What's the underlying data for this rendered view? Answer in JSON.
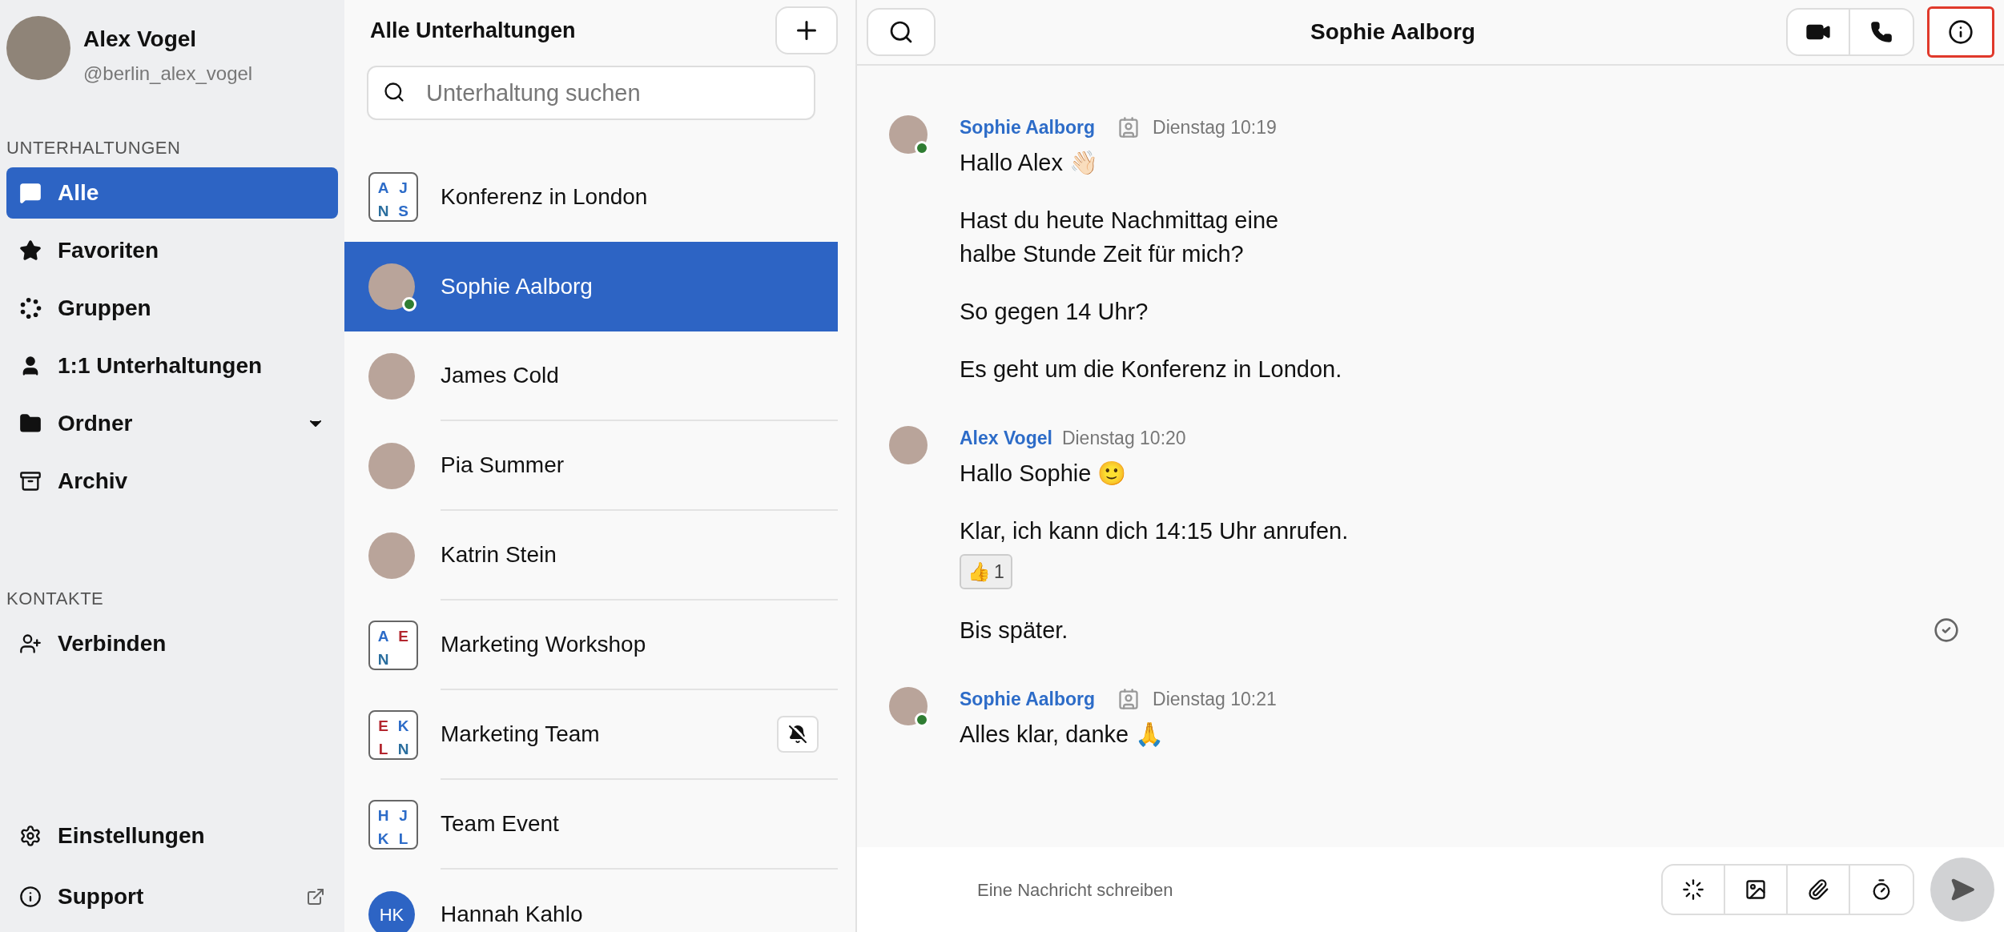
{
  "profile": {
    "name": "Alex Vogel",
    "handle": "@berlin_alex_vogel"
  },
  "sections": [
    {
      "title": "UNTERHALTUNGEN",
      "items": [
        {
          "label": "Alle",
          "selected": true
        },
        {
          "label": "Favoriten",
          "selected": false
        },
        {
          "label": "Gruppen",
          "selected": false
        },
        {
          "label": "1:1 Unterhaltungen",
          "selected": false
        },
        {
          "label": "Ordner",
          "selected": false,
          "dropdown": true
        },
        {
          "label": "Archiv",
          "selected": false
        }
      ]
    },
    {
      "title": "KONTAKTE",
      "items": [
        {
          "label": "Verbinden",
          "selected": false
        }
      ]
    }
  ],
  "bottom_items": [
    {
      "label": "Einstellungen",
      "external": false
    },
    {
      "label": "Support",
      "external": true
    }
  ],
  "conversation_list": {
    "title": "Alle Unterhaltungen",
    "search": {
      "placeholder": "Unterhaltung suchen"
    },
    "items": [
      {
        "name": "Konferenz in London",
        "kind": "group",
        "selected": false,
        "initials": [
          {
            "letter": "A",
            "color": "#2d6cc8"
          },
          {
            "letter": "J",
            "color": "#2d6cc8"
          },
          {
            "letter": "N",
            "color": "#2a6e9e"
          },
          {
            "letter": "S",
            "color": "#2d6cc8"
          }
        ]
      },
      {
        "name": "Sophie Aalborg",
        "kind": "photo",
        "selected": true,
        "online": true
      },
      {
        "name": "James Cold",
        "kind": "photo",
        "selected": false,
        "online": false
      },
      {
        "name": "Pia Summer",
        "kind": "photo",
        "selected": false,
        "online": false
      },
      {
        "name": "Katrin Stein",
        "kind": "photo",
        "selected": false,
        "online": false
      },
      {
        "name": "Marketing Workshop",
        "kind": "group",
        "selected": false,
        "initials": [
          {
            "letter": "A",
            "color": "#2d6cc8"
          },
          {
            "letter": "E",
            "color": "#b3262e"
          },
          {
            "letter": "N",
            "color": "#2a6e9e"
          }
        ]
      },
      {
        "name": "Marketing Team",
        "kind": "group",
        "selected": false,
        "muted": true,
        "initials": [
          {
            "letter": "E",
            "color": "#b3262e"
          },
          {
            "letter": "K",
            "color": "#2d6cc8"
          },
          {
            "letter": "L",
            "color": "#b3262e"
          },
          {
            "letter": "N",
            "color": "#2a6e9e"
          }
        ]
      },
      {
        "name": "Team Event",
        "kind": "group",
        "selected": false,
        "initials": [
          {
            "letter": "H",
            "color": "#2d6cc8"
          },
          {
            "letter": "J",
            "color": "#2d6cc8"
          },
          {
            "letter": "K",
            "color": "#2d6cc8"
          },
          {
            "letter": "L",
            "color": "#2d6cc8"
          }
        ]
      },
      {
        "name": "Hannah Kahlo",
        "kind": "monogram",
        "selected": false,
        "monogram": "HK"
      }
    ]
  },
  "chat": {
    "title": "Sophie Aalborg",
    "info_highlighted": true,
    "messages": [
      {
        "sender": "Sophie Aalborg",
        "badge": true,
        "online": true,
        "time": "Dienstag 10:19",
        "lines": [
          {
            "text": "Hallo Alex 👋🏻"
          },
          {
            "text": "Hast du heute Nachmittag eine\nhalbe Stunde Zeit für mich?"
          },
          {
            "text": "So gegen 14 Uhr?"
          },
          {
            "text": "Es geht um die Konferenz in London."
          }
        ]
      },
      {
        "sender": "Alex Vogel",
        "badge": false,
        "online": false,
        "time": "Dienstag 10:20",
        "lines": [
          {
            "text": "Hallo Sophie 🙂"
          },
          {
            "text": "Klar, ich kann dich 14:15 Uhr anrufen.",
            "reaction": {
              "emoji": "👍",
              "count": "1"
            }
          },
          {
            "text": "Bis später.",
            "read": true
          }
        ]
      },
      {
        "sender": "Sophie Aalborg",
        "badge": true,
        "online": true,
        "time": "Dienstag 10:21",
        "lines": [
          {
            "text": "Alles klar, danke 🙏"
          }
        ]
      }
    ],
    "composer": {
      "placeholder": "Eine Nachricht schreiben"
    }
  }
}
